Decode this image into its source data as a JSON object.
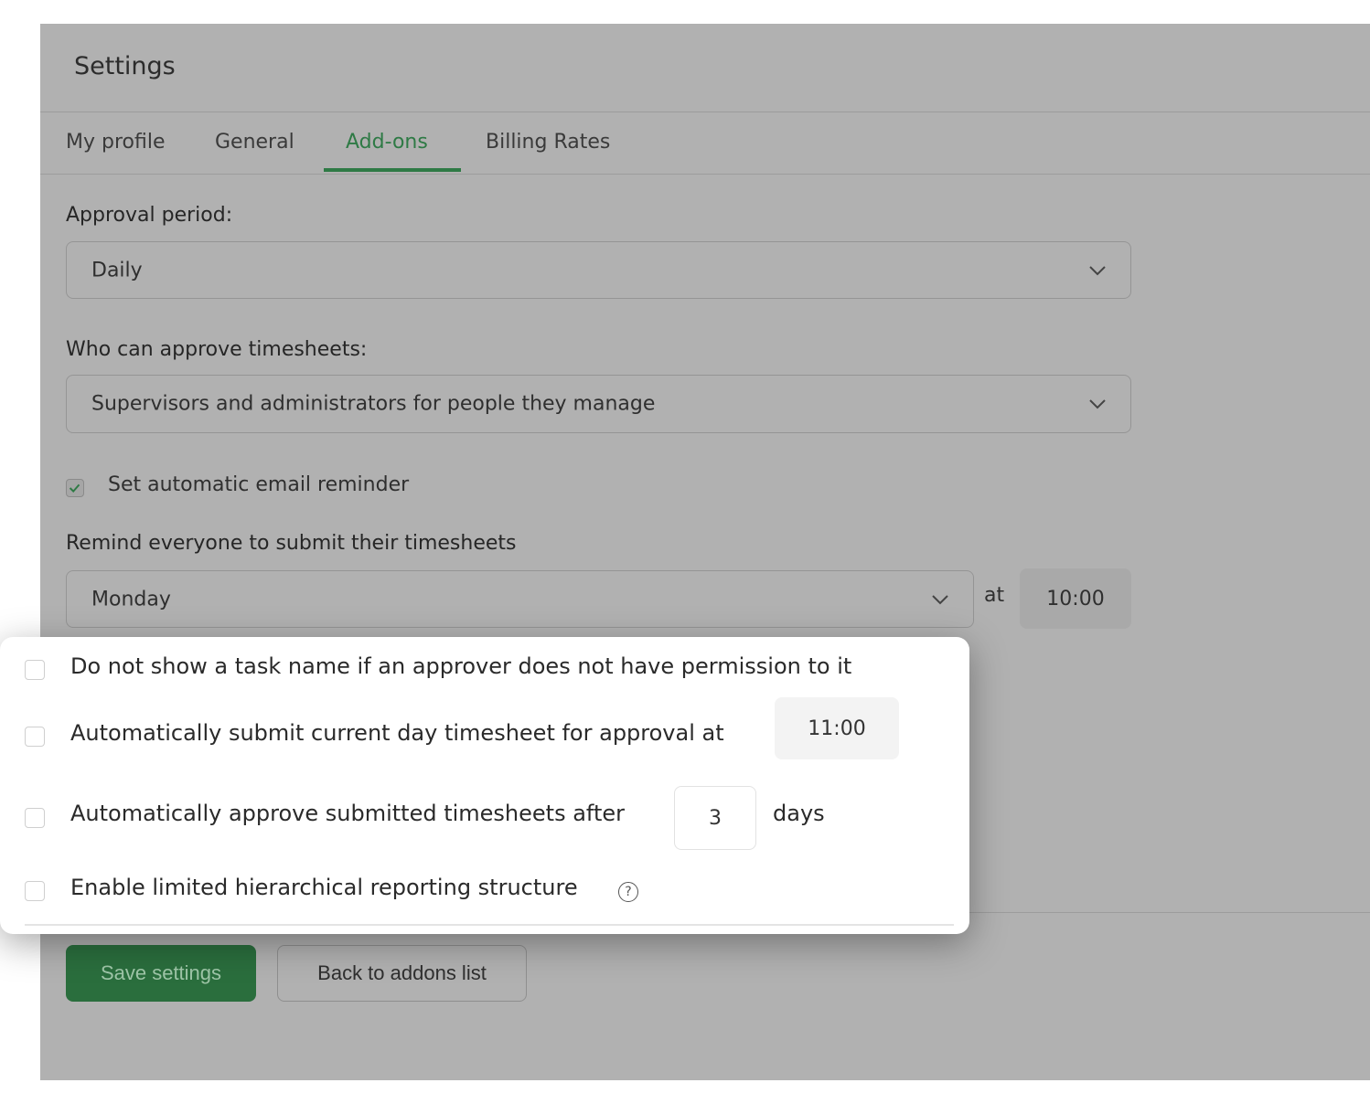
{
  "header": {
    "title": "Settings"
  },
  "tabs": [
    {
      "label": "My profile",
      "active": false
    },
    {
      "label": "General",
      "active": false
    },
    {
      "label": "Add-ons",
      "active": true
    },
    {
      "label": "Billing Rates",
      "active": false
    }
  ],
  "approval_period": {
    "label": "Approval period:",
    "value": "Daily"
  },
  "approvers": {
    "label": "Who can approve timesheets:",
    "value": "Supervisors and administrators for people they manage"
  },
  "email_reminder": {
    "label": "Set automatic email reminder",
    "checked": true
  },
  "remind": {
    "label": "Remind everyone to submit their timesheets",
    "day": "Monday",
    "at_label": "at",
    "time": "10:00"
  },
  "options": {
    "hide_task_name": {
      "label": "Do not show a task name if an approver does not have permission to it",
      "checked": false
    },
    "auto_submit": {
      "label": "Automatically submit current day timesheet for approval at",
      "time": "11:00",
      "checked": false
    },
    "auto_approve": {
      "label": "Automatically approve submitted timesheets after",
      "days": "3",
      "unit": "days",
      "checked": false
    },
    "hierarchy": {
      "label": "Enable limited hierarchical reporting structure",
      "help_glyph": "?",
      "checked": false
    }
  },
  "actions": {
    "save_label": "Save settings",
    "back_label": "Back to addons list"
  },
  "colors": {
    "accent": "#2e7a45",
    "overlay": "#b1b1b1",
    "save_bg": "#2a6e3d"
  },
  "icons": [
    "chevron-down-icon",
    "checkmark-icon",
    "help-circle-icon"
  ]
}
